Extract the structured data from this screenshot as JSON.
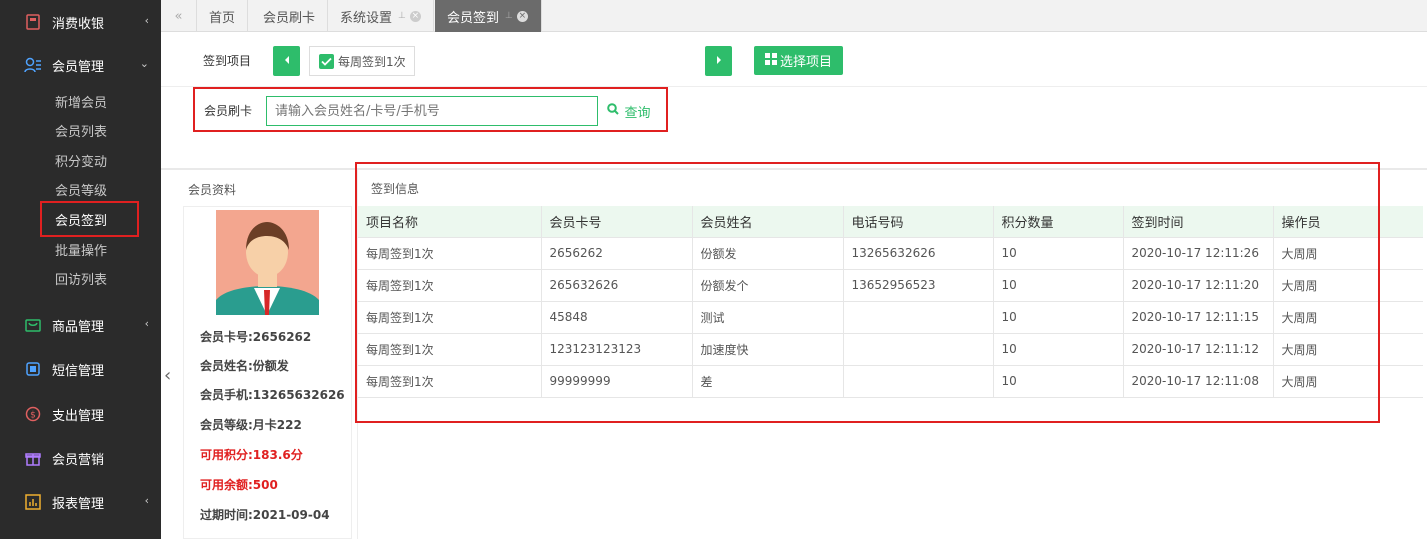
{
  "sidebar": {
    "groups": [
      {
        "label": "消费收银",
        "icon": "cash-register-icon"
      },
      {
        "label": "会员管理",
        "icon": "member-icon"
      },
      {
        "label": "商品管理",
        "icon": "goods-icon"
      },
      {
        "label": "短信管理",
        "icon": "sms-icon"
      },
      {
        "label": "支出管理",
        "icon": "expense-icon"
      },
      {
        "label": "会员营销",
        "icon": "gift-icon"
      },
      {
        "label": "报表管理",
        "icon": "report-icon"
      }
    ],
    "sub_items": [
      "新增会员",
      "会员列表",
      "积分变动",
      "会员等级",
      "会员签到",
      "批量操作",
      "回访列表"
    ]
  },
  "tabs": {
    "nav_back": "«",
    "items": [
      {
        "label": "首页"
      },
      {
        "label": "会员刷卡"
      },
      {
        "label": "系统设置"
      },
      {
        "label": "会员签到"
      }
    ]
  },
  "toolbar": {
    "project_label": "签到项目",
    "project_checkbox_label": "每周签到1次",
    "choose_button": "选择项目",
    "card_label": "会员刷卡",
    "search_placeholder": "请输入会员姓名/卡号/手机号",
    "search_button": "查询"
  },
  "member": {
    "section_title": "会员资料",
    "lines": [
      "会员卡号:2656262",
      "会员姓名:份额发",
      "会员手机:13265632626",
      "会员等级:月卡222",
      "可用积分:183.6分",
      "可用余额:500",
      "过期时间:2021-09-04"
    ]
  },
  "signin": {
    "section_title": "签到信息",
    "columns": [
      "项目名称",
      "会员卡号",
      "会员姓名",
      "电话号码",
      "积分数量",
      "签到时间",
      "操作员"
    ],
    "rows": [
      [
        "每周签到1次",
        "2656262",
        "份额发",
        "13265632626",
        "10",
        "2020-10-17 12:11:26",
        "大周周"
      ],
      [
        "每周签到1次",
        "265632626",
        "份额发个",
        "13652956523",
        "10",
        "2020-10-17 12:11:20",
        "大周周"
      ],
      [
        "每周签到1次",
        "45848",
        "测试",
        "",
        "10",
        "2020-10-17 12:11:15",
        "大周周"
      ],
      [
        "每周签到1次",
        "123123123123",
        "加速度快",
        "",
        "10",
        "2020-10-17 12:11:12",
        "大周周"
      ],
      [
        "每周签到1次",
        "99999999",
        "差",
        "",
        "10",
        "2020-10-17 12:11:08",
        "大周周"
      ]
    ]
  },
  "colors": {
    "accent": "#2ebd6b",
    "sidebar": "#2b2b2b",
    "highlight": "#e02020"
  }
}
